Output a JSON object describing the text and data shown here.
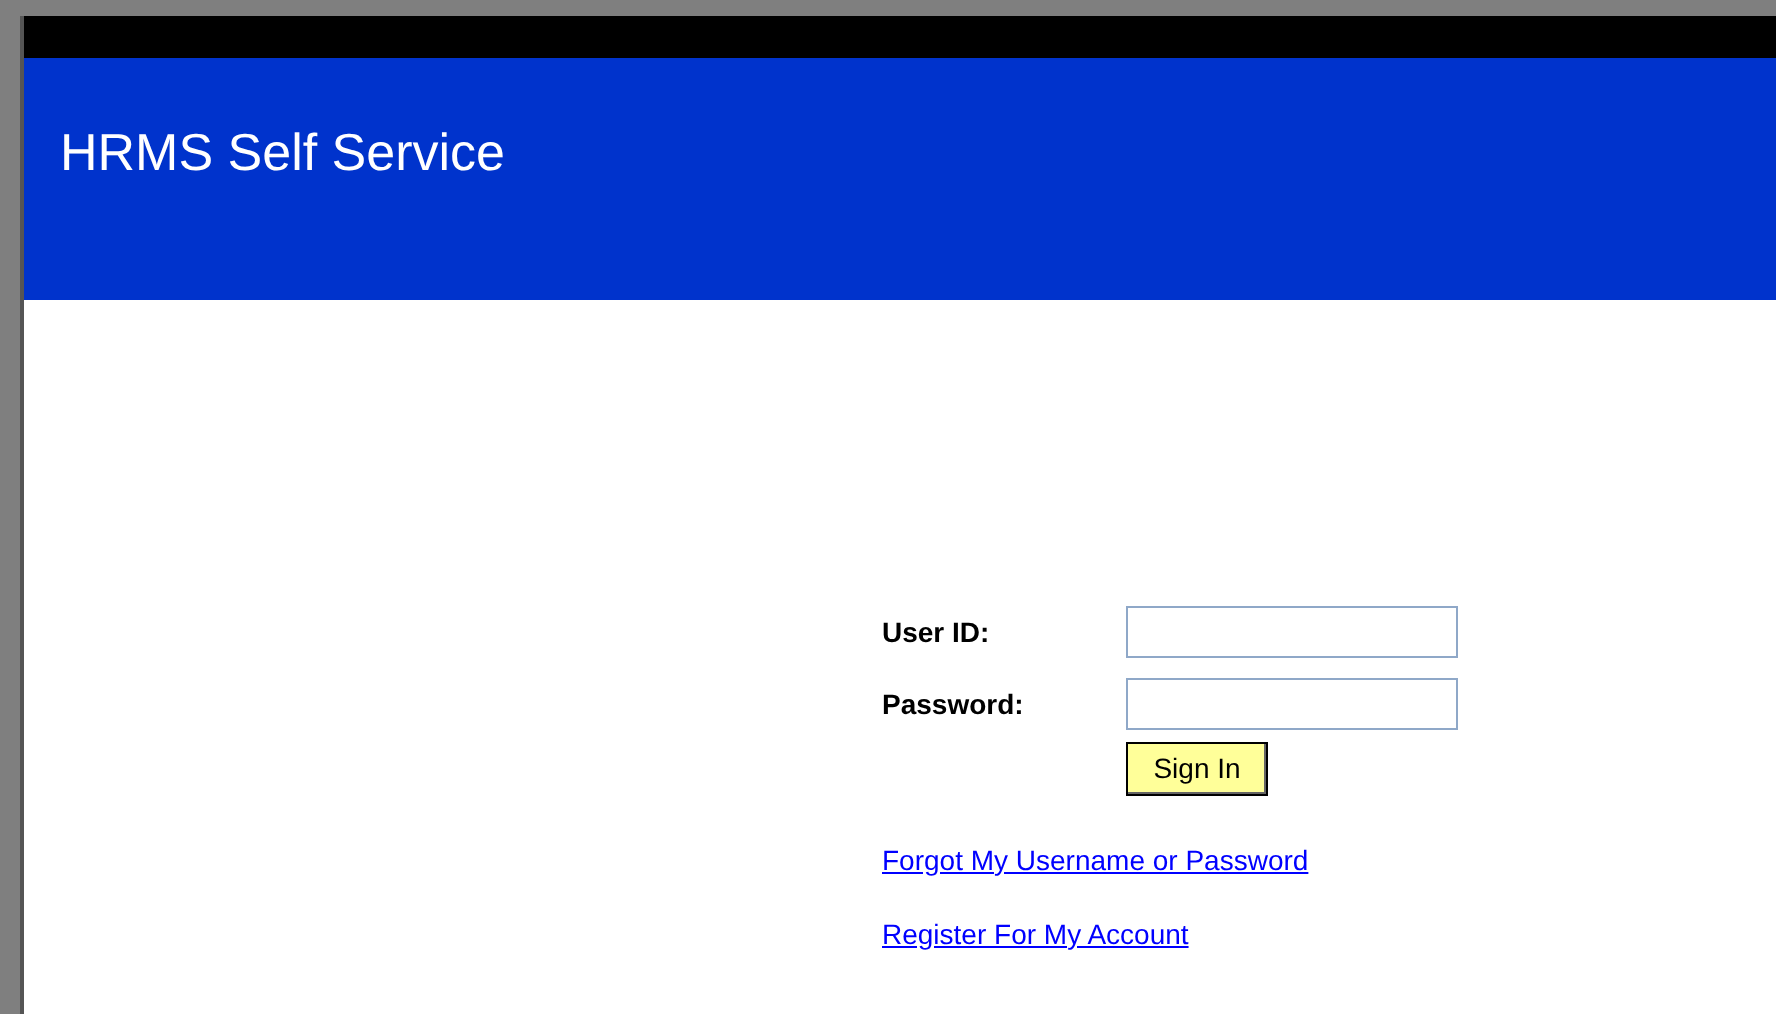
{
  "header": {
    "title": "HRMS Self Service"
  },
  "form": {
    "fields": [
      {
        "label": "User ID:"
      },
      {
        "label": "Password:"
      }
    ],
    "button": "Sign In"
  },
  "links": [
    "Forgot My Username or Password",
    "Register For My Account"
  ]
}
